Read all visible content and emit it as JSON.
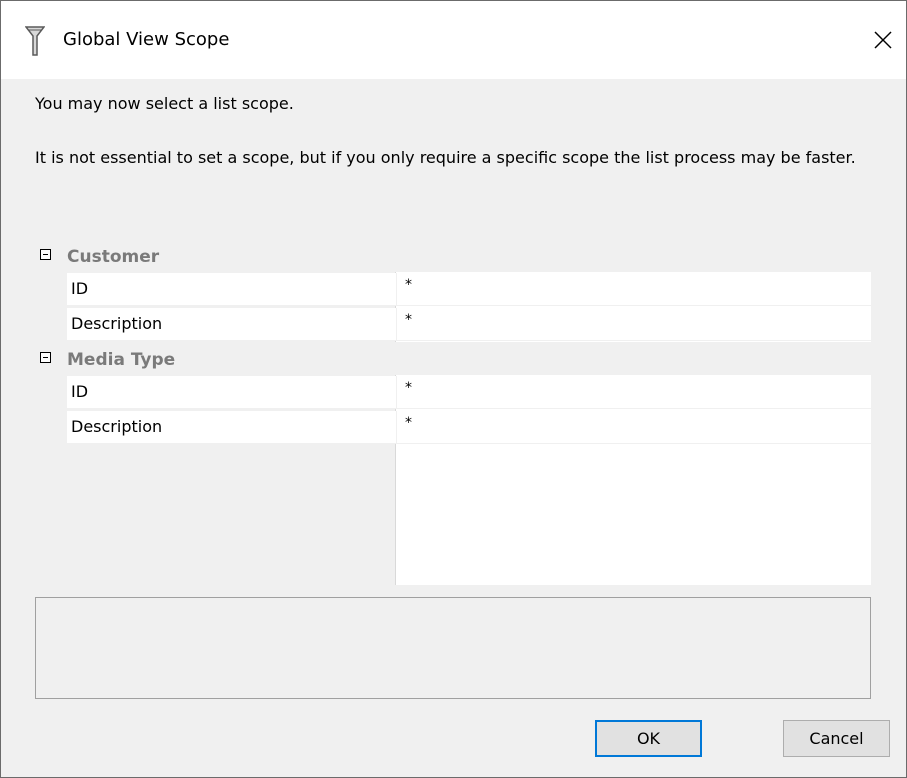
{
  "window": {
    "title": "Global View Scope",
    "icon": "funnel-icon",
    "close_icon": "close-icon"
  },
  "messages": {
    "line1": "You may now select a list scope.",
    "line2": "It is not essential to set a scope, but if you only require a specific scope the list process may be faster."
  },
  "property_grid": {
    "categories": [
      {
        "label": "Customer",
        "expanded": true,
        "properties": [
          {
            "name": "ID",
            "value": "*"
          },
          {
            "name": "Description",
            "value": "*"
          }
        ]
      },
      {
        "label": "Media Type",
        "expanded": true,
        "properties": [
          {
            "name": "ID",
            "value": "*"
          },
          {
            "name": "Description",
            "value": "*"
          }
        ]
      }
    ]
  },
  "description_panel": {
    "text": ""
  },
  "buttons": {
    "ok_label": "OK",
    "cancel_label": "Cancel"
  },
  "colors": {
    "accent": "#0078d7",
    "category_text": "#7a7a7a",
    "dialog_bg": "#f0f0f0"
  }
}
